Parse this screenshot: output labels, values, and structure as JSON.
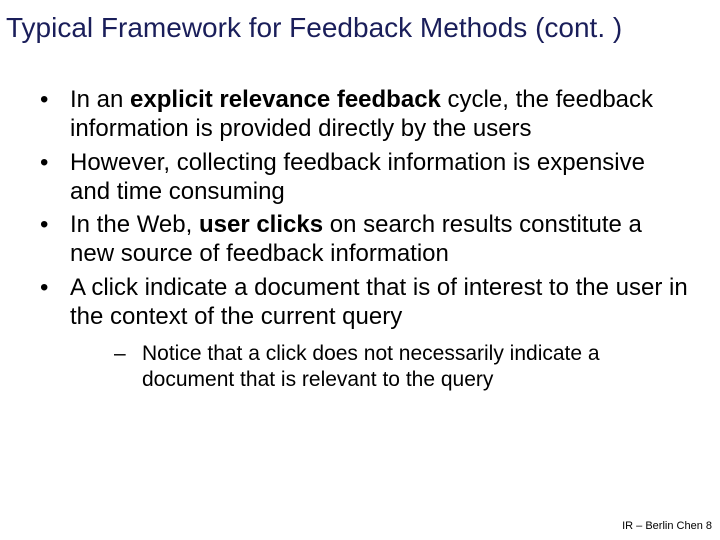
{
  "title": "Typical Framework for Feedback Methods (cont. )",
  "bullets": {
    "b1_a": "In an ",
    "b1_b": "explicit relevance feedback",
    "b1_c": " cycle, the feedback information is provided directly by the users",
    "b2": "However, collecting feedback information is expensive and time consuming",
    "b3_a": "In the Web, ",
    "b3_b": "user clicks",
    "b3_c": " on search results constitute a new source of feedback information",
    "b4": "A click indicate a document that is of interest to the user in the context of the current query",
    "s1": "Notice that a click does not necessarily indicate a document that is relevant to the query"
  },
  "footer": "IR – Berlin Chen 8"
}
